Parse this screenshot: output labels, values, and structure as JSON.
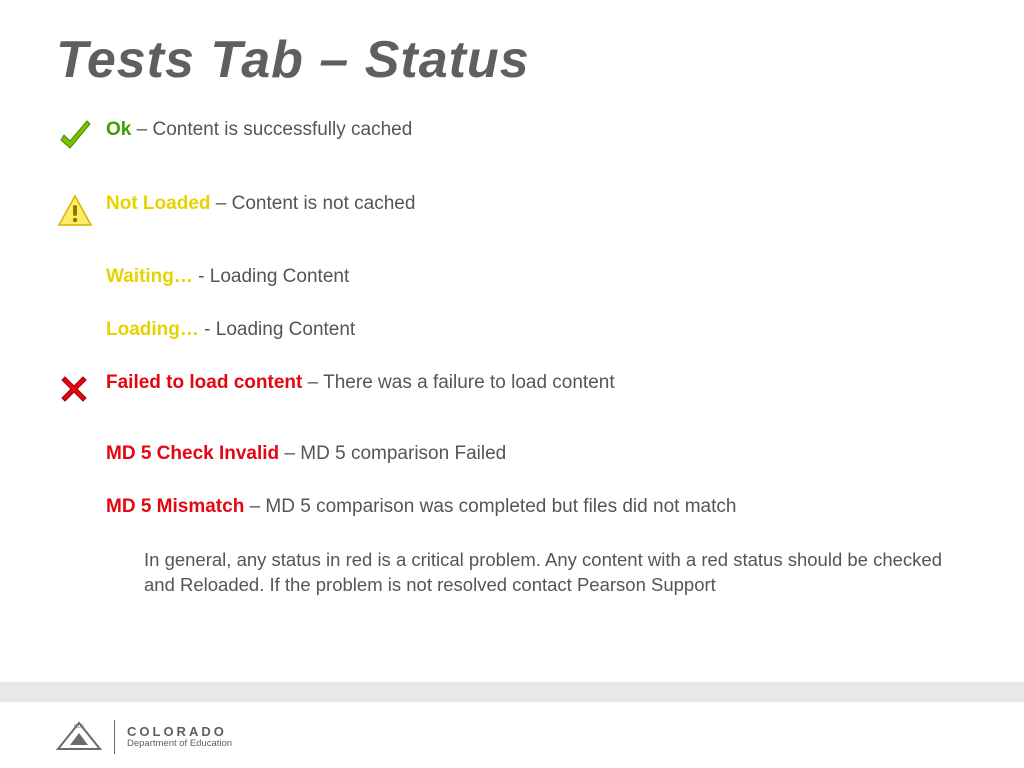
{
  "title": "Tests Tab – Status",
  "items": [
    {
      "icon": "check",
      "label": "Ok",
      "label_class": "label-green",
      "desc": " – Content is successfully cached"
    },
    {
      "icon": "warn",
      "label": "Not Loaded",
      "label_class": "label-yellow",
      "desc": " – Content is not cached"
    },
    {
      "icon": "",
      "label": "Waiting… ",
      "label_class": "label-yellow",
      "desc": "- Loading Content"
    },
    {
      "icon": "",
      "label": "Loading… ",
      "label_class": "label-yellow",
      "desc": "- Loading Content"
    },
    {
      "icon": "fail",
      "label": "Failed to load content",
      "label_class": "label-red",
      "desc": " – There was a failure to load content"
    },
    {
      "icon": "",
      "label": "MD 5 Check Invalid",
      "label_class": "label-red",
      "desc": " – MD 5 comparison Failed"
    },
    {
      "icon": "",
      "label": "MD 5 Mismatch",
      "label_class": "label-red",
      "desc": " – MD 5 comparison was completed but files did not match"
    }
  ],
  "footnote": "In general, any status in red is a critical problem.  Any content with a red status should be checked and Reloaded.  If the problem is not resolved contact Pearson Support",
  "footer": {
    "line1": "COLORADO",
    "line2": "Department of Education"
  }
}
